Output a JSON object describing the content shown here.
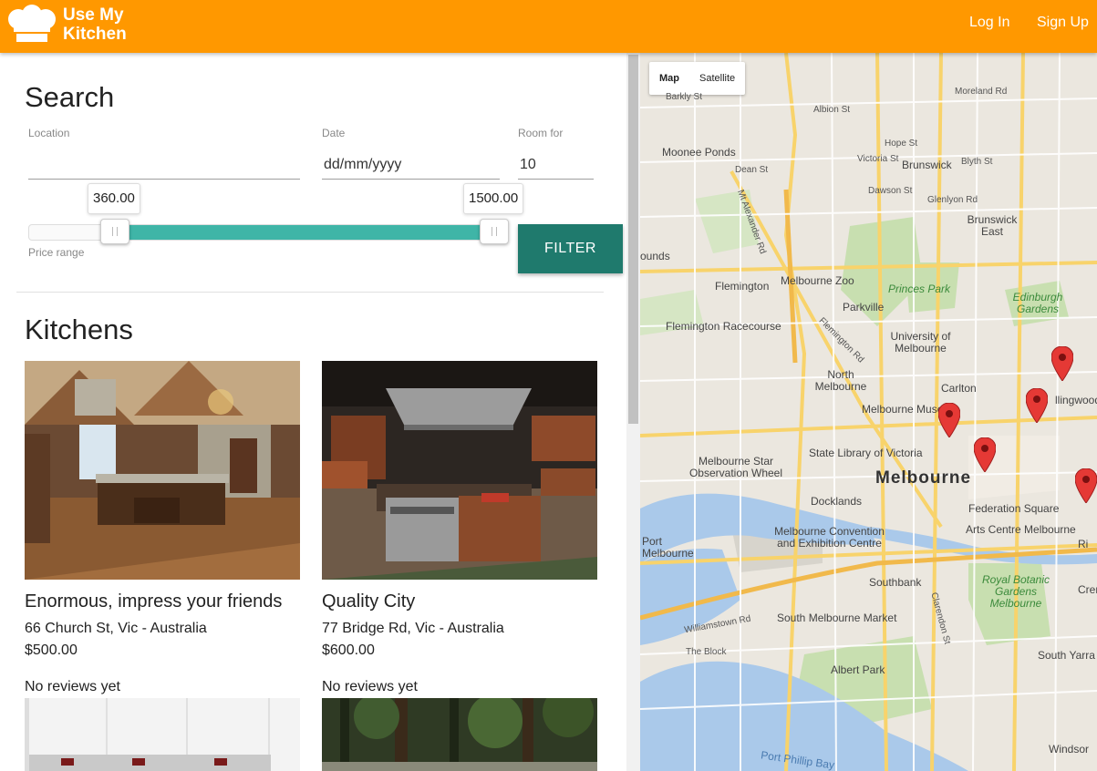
{
  "header": {
    "brand_line1": "Use My",
    "brand_line2": "Kitchen",
    "login": "Log In",
    "signup": "Sign Up",
    "color": "#ff9800"
  },
  "search": {
    "title": "Search",
    "location_label": "Location",
    "location_value": "",
    "date_label": "Date",
    "date_value": "dd/mm/yyyy",
    "room_label": "Room for",
    "room_value": "10",
    "price_min": "360.00",
    "price_max": "1500.00",
    "price_label": "Price range",
    "filter_label": "FILTER"
  },
  "kitchens": {
    "title": "Kitchens",
    "items": [
      {
        "name": "Enormous, impress your friends",
        "address": "66 Church St, Vic - Australia",
        "price": "$500.00",
        "reviews": "No reviews yet"
      },
      {
        "name": "Quality City",
        "address": "77 Bridge Rd, Vic - Australia",
        "price": "$600.00",
        "reviews": "No reviews yet"
      }
    ]
  },
  "map": {
    "type_map": "Map",
    "type_satellite": "Satellite",
    "labels": {
      "melbourne": "Melbourne",
      "brunswick": "Brunswick",
      "brunswick_east": "Brunswick East",
      "moonee_ponds": "Moonee Ponds",
      "flemington": "Flemington",
      "flemington_racecourse": "Flemington Racecourse",
      "melbourne_zoo": "Melbourne Zoo",
      "princes_park": "Princes Park",
      "parkville": "Parkville",
      "edinburgh_gardens": "Edinburgh Gardens",
      "uni": "University of Melbourne",
      "north_melbourne": "North Melbourne",
      "carlton": "Carlton",
      "museum": "Melbourne Museum",
      "collingwood": "llingwood",
      "state_library": "State Library of Victoria",
      "star": "Melbourne Star Observation Wheel",
      "docklands": "Docklands",
      "fed_square": "Federation Square",
      "arts_centre": "Arts Centre Melbourne",
      "convention": "Melbourne Convention and Exhibition Centre",
      "port_melbourne": "Port Melbourne",
      "southbank": "Southbank",
      "south_melbourne_market": "South Melbourne Market",
      "royal_botanic": "Royal Botanic Gardens Melbourne",
      "albert_park": "Albert Park",
      "south_yarra": "South Yarra",
      "windsor": "Windsor",
      "port_phillip": "Port Phillip Bay",
      "mt_alexander": "Mt Alexander Rd",
      "flemington_rd": "Flemington Rd",
      "williamstown_rd": "Williamstown Rd",
      "clarendon": "Clarendon St",
      "albion": "Albion St",
      "moreland": "Moreland Rd",
      "hope": "Hope St",
      "victoria": "Victoria St",
      "blyth": "Blyth St",
      "dawson": "Dawson St",
      "glenlyon": "Glenlyon Rd",
      "dean": "Dean St",
      "barkly": "Barkly St",
      "hounds": "ounds",
      "cremorne": "Cremo",
      "richmond": "Ri",
      "the_block": "The Block"
    }
  }
}
